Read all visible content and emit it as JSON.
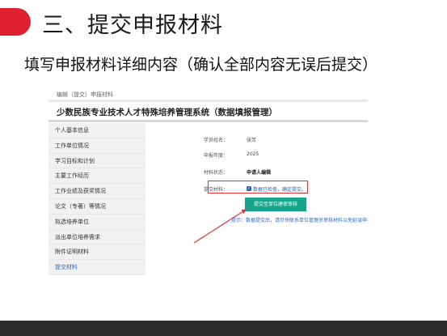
{
  "slide": {
    "title": "三、提交申报材料",
    "subtitle": "填写申报材料详细内容（确认全部内容无误后提交）"
  },
  "app": {
    "breadcrumb": "编辑（提交）申报材料",
    "system_title": "少数民族专业技术人才特殊培养管理系统（数据填报管理）"
  },
  "sidebar": {
    "items": [
      {
        "label": "个人基本信息"
      },
      {
        "label": "工作单位情况"
      },
      {
        "label": "学习目标和计划"
      },
      {
        "label": "主要工作经历"
      },
      {
        "label": "工作业绩及获奖情况"
      },
      {
        "label": "论文（专著）等情况"
      },
      {
        "label": "拟选培养单位"
      },
      {
        "label": "派出单位培养需求"
      },
      {
        "label": "附件证明材料"
      },
      {
        "label": "提交材料"
      }
    ],
    "active_index": 9
  },
  "form": {
    "name_label": "学员姓名：",
    "name_value": "张芳",
    "year_label": "申报年度：",
    "year_value": "2025",
    "status_label": "材料状态：",
    "status_value": "申请人编辑",
    "submit_label": "提交材料：",
    "confirm_text": "数据已检查，确定提交。",
    "confirm_checked": true,
    "submit_button": "提交至单位建审审核",
    "tip": "提示：数据提交后，请尽快联系单位管理员审核材料以免延误申报。"
  },
  "colors": {
    "accent": "#e0202e",
    "button": "#16a58a",
    "link": "#2a6ac8",
    "highlight_box": "#e23232"
  }
}
